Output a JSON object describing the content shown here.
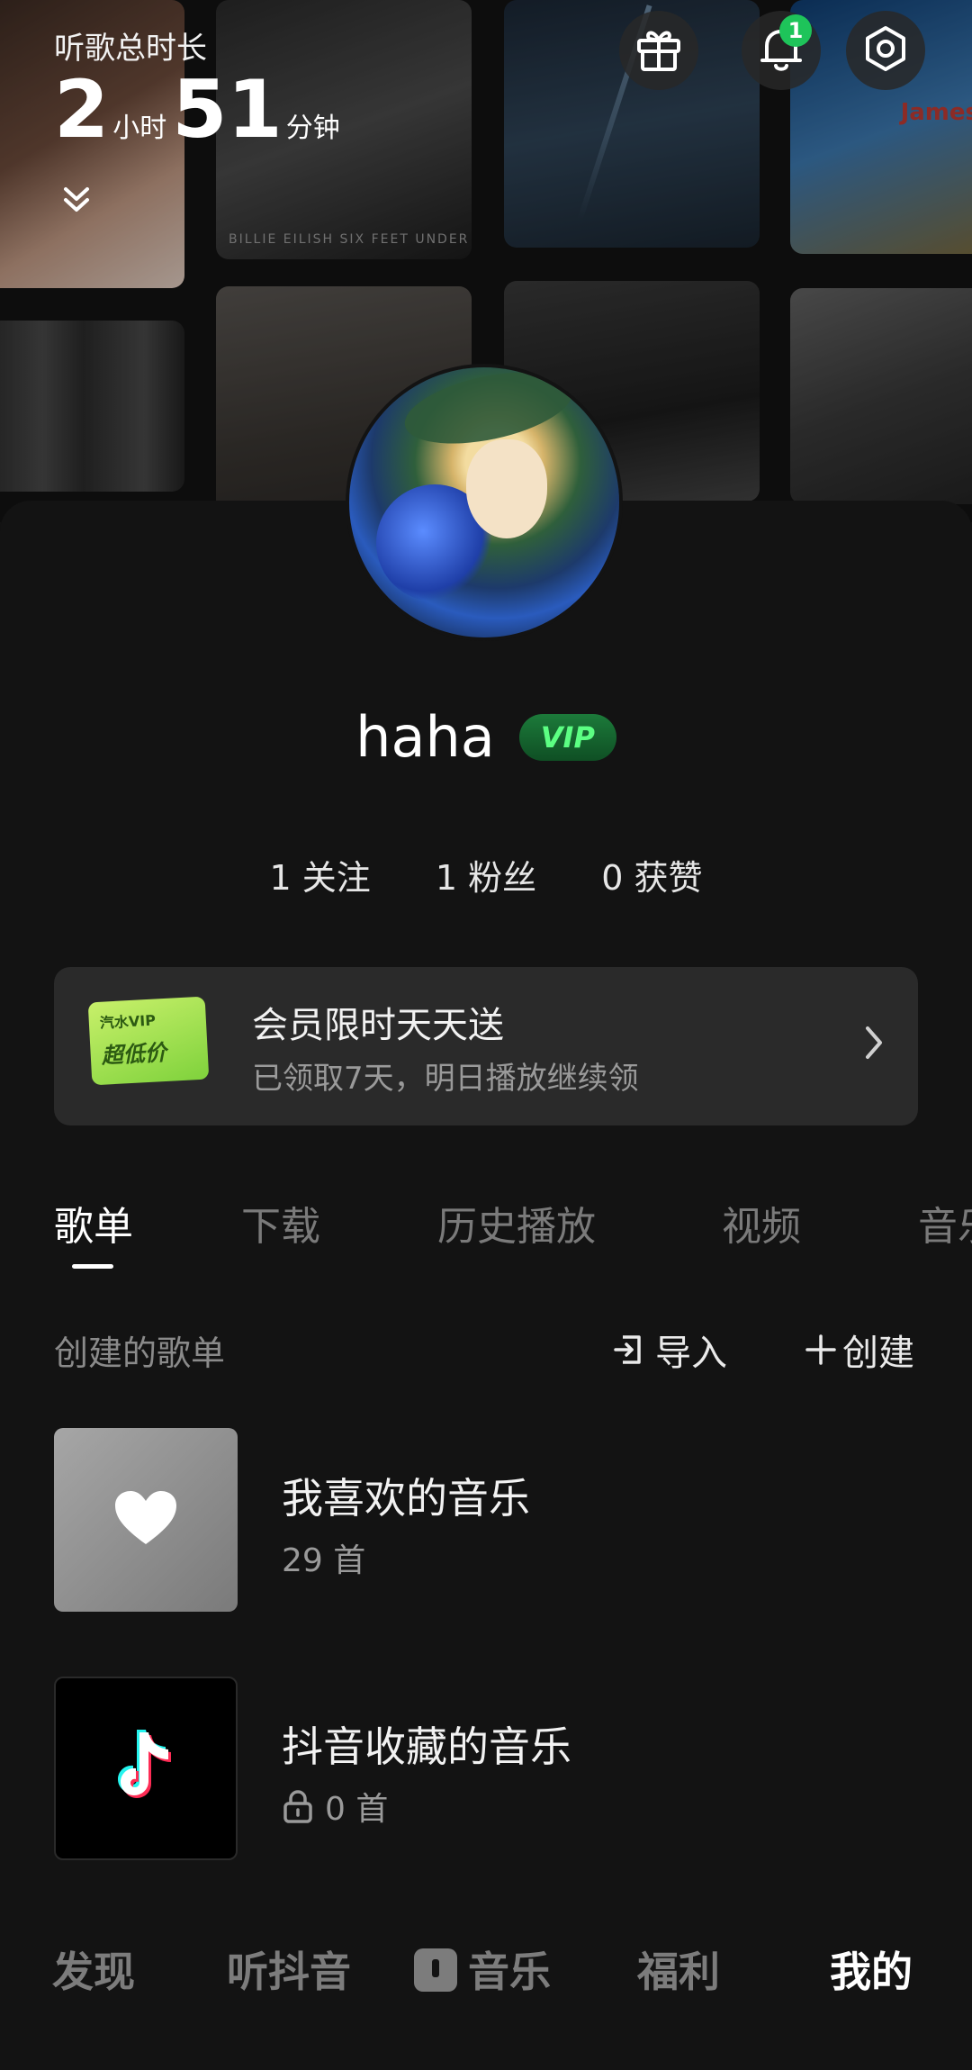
{
  "header": {
    "listen_title": "听歌总时长",
    "hours": "2",
    "hours_unit": "小时",
    "minutes": "51",
    "minutes_unit": "分钟",
    "notification_count": "1"
  },
  "album_covers": {
    "cover2_text": "BILLIE EILISH    SIX FEET UNDER",
    "cover4_text": "James"
  },
  "profile": {
    "username": "haha",
    "vip_label": "VIP",
    "stats": [
      {
        "count": "1",
        "label": "关注"
      },
      {
        "count": "1",
        "label": "粉丝"
      },
      {
        "count": "0",
        "label": "获赞"
      }
    ]
  },
  "promo": {
    "ticket_line1": "汽水VIP",
    "ticket_line2": "超低价",
    "title": "会员限时天天送",
    "subtitle": "已领取7天，明日播放继续领"
  },
  "tabs": [
    "歌单",
    "下载",
    "历史播放",
    "视频",
    "音乐"
  ],
  "playlists_section": {
    "heading": "创建的歌单",
    "import_label": "导入",
    "create_label": "创建",
    "items": [
      {
        "title": "我喜欢的音乐",
        "count": "29 首"
      },
      {
        "title": "抖音收藏的音乐",
        "count": "0 首"
      }
    ]
  },
  "bottom_nav": [
    "发现",
    "听抖音",
    "音乐",
    "福利",
    "我的"
  ]
}
